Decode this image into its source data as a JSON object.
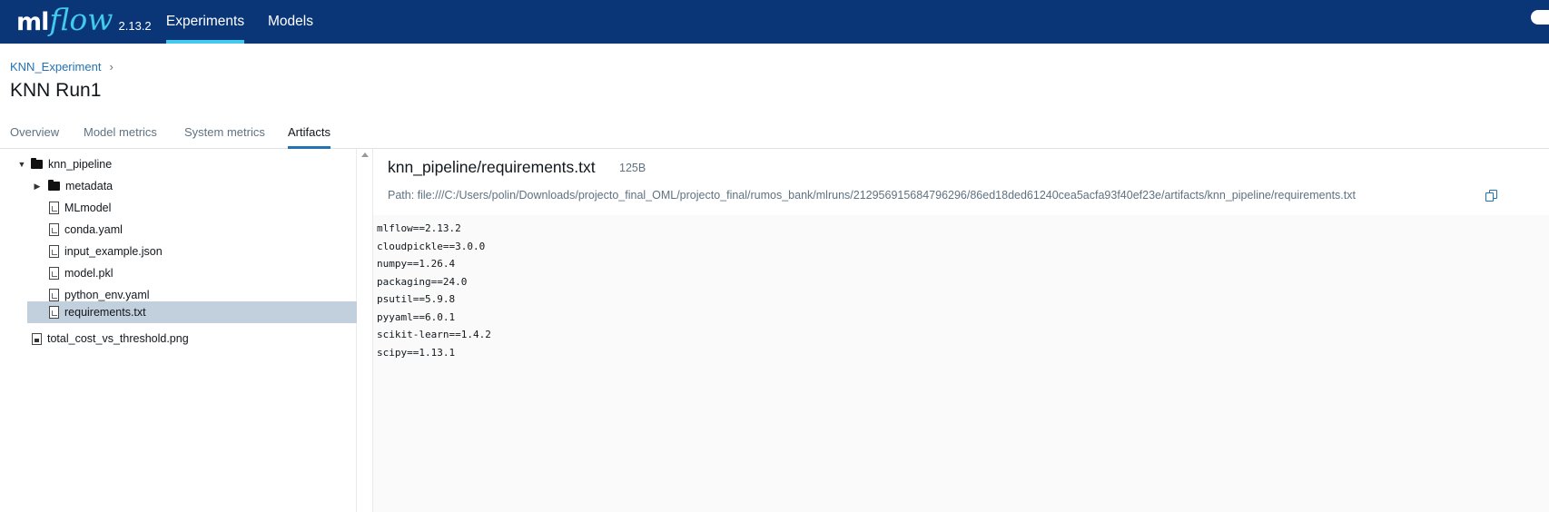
{
  "topbar": {
    "logo_ml": "ml",
    "logo_flow": "flow",
    "version": "2.13.2",
    "nav": [
      {
        "label": "Experiments",
        "active": true
      },
      {
        "label": "Models",
        "active": false
      }
    ]
  },
  "header": {
    "breadcrumb": "KNN_Experiment",
    "breadcrumb_sep": "›",
    "title": "KNN Run1"
  },
  "tabs": [
    {
      "label": "Overview",
      "active": false
    },
    {
      "label": "Model metrics",
      "active": false
    },
    {
      "label": "System metrics",
      "active": false
    },
    {
      "label": "Artifacts",
      "active": true
    }
  ],
  "tree": {
    "root_folder": "knn_pipeline",
    "metadata_folder": "metadata",
    "files": [
      "MLmodel",
      "conda.yaml",
      "input_example.json",
      "model.pkl",
      "python_env.yaml",
      "requirements.txt"
    ],
    "selected": "requirements.txt",
    "root_image": "total_cost_vs_threshold.png"
  },
  "artifact": {
    "title": "knn_pipeline/requirements.txt",
    "size": "125B",
    "path": "Path: file:///C:/Users/polin/Downloads/projecto_final_OML/projecto_final/rumos_bank/mlruns/212956915684796296/86ed18ded61240cea5acfa93f40ef23e/artifacts/knn_pipeline/requirements.txt",
    "lines": [
      "mlflow==2.13.2",
      "cloudpickle==3.0.0",
      "numpy==1.26.4",
      "packaging==24.0",
      "psutil==5.9.8",
      "pyyaml==6.0.1",
      "scikit-learn==1.4.2",
      "scipy==1.13.1"
    ]
  },
  "colors": {
    "topbar": "#0a3677",
    "accent": "#43c9ed",
    "link": "#2272b4",
    "selected_row": "#c2cfdd"
  }
}
